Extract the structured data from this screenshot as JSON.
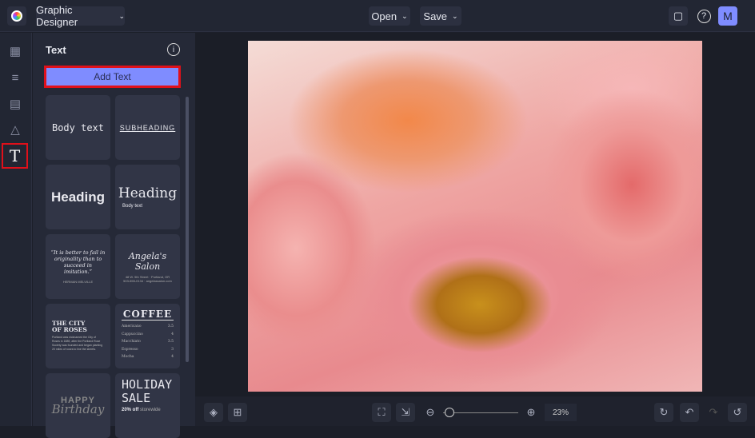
{
  "header": {
    "app_title": "Graphic Designer",
    "open_label": "Open",
    "save_label": "Save",
    "avatar_initial": "M"
  },
  "panel": {
    "title": "Text",
    "add_text_label": "Add Text",
    "templates": {
      "body": "Body text",
      "subheading": "SUBHEADING",
      "heading_bold": "Heading",
      "heading_serif": "Heading",
      "heading_serif_sub": "Body text",
      "quote": "“It is better to fail in originality than to succeed in imitation.”",
      "quote_author": "HERMAN MELVILLE",
      "salon_title": "Angela's Salon",
      "salon_line1": "48 W. 5th Street · Portland, OR",
      "salon_line2": "503-555-0134 · angelassalon.com",
      "city_title": "THE CITY OF ROSES",
      "city_body": "Portland was nicknamed the City of Roses in 1889, after the Portland Rose Society was founded and began planting 20 miles of roses to line the streets.",
      "coffee_title": "COFFEE",
      "coffee_items": [
        {
          "name": "Americano",
          "price": "3.5"
        },
        {
          "name": "Cappuccino",
          "price": "4"
        },
        {
          "name": "Macchiato",
          "price": "3.5"
        },
        {
          "name": "Espresso",
          "price": "3"
        },
        {
          "name": "Mocha",
          "price": "4"
        }
      ],
      "birthday_top": "HAPPY",
      "birthday_bottom": "Birthday",
      "holiday_title": "HOLIDAY SALE",
      "holiday_off": "20% off",
      "holiday_sub": "storewide"
    }
  },
  "toolbar": {
    "zoom_percent": "23%",
    "zoom_value": 23
  },
  "colors": {
    "accent": "#7f8cff",
    "highlight": "#e0101a"
  }
}
